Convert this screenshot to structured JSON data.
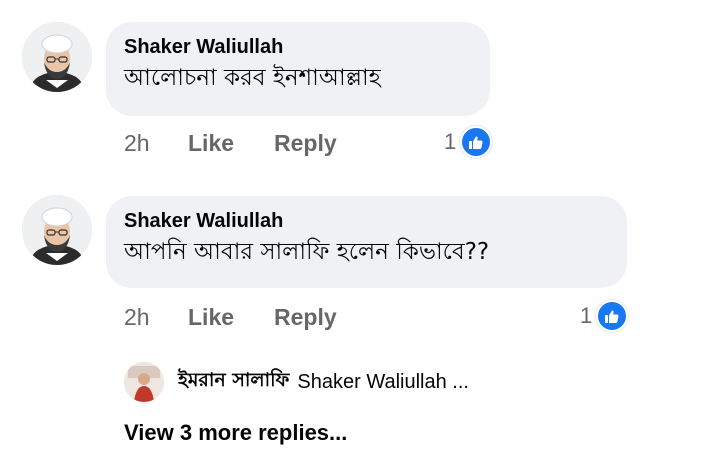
{
  "comments": [
    {
      "author": "Shaker Waliullah",
      "text": "আলোচনা করব ইনশাআল্লাহ",
      "time": "2h",
      "like_label": "Like",
      "reply_label": "Reply",
      "reaction_count": "1",
      "reaction_icon": "thumbs-up-icon"
    },
    {
      "author": "Shaker Waliullah",
      "text": "আপনি আবার সালাফি হলেন কিভাবে??",
      "time": "2h",
      "like_label": "Like",
      "reply_label": "Reply",
      "reaction_count": "1",
      "reaction_icon": "thumbs-up-icon"
    }
  ],
  "reply_preview": {
    "author": "ইমরান সালাফি",
    "snippet": "Shaker Waliullah ..."
  },
  "view_more_label": "View 3 more replies...",
  "colors": {
    "bubble": "#eff1f4",
    "meta_text": "#65676b",
    "like_blue": "#1877f2"
  }
}
